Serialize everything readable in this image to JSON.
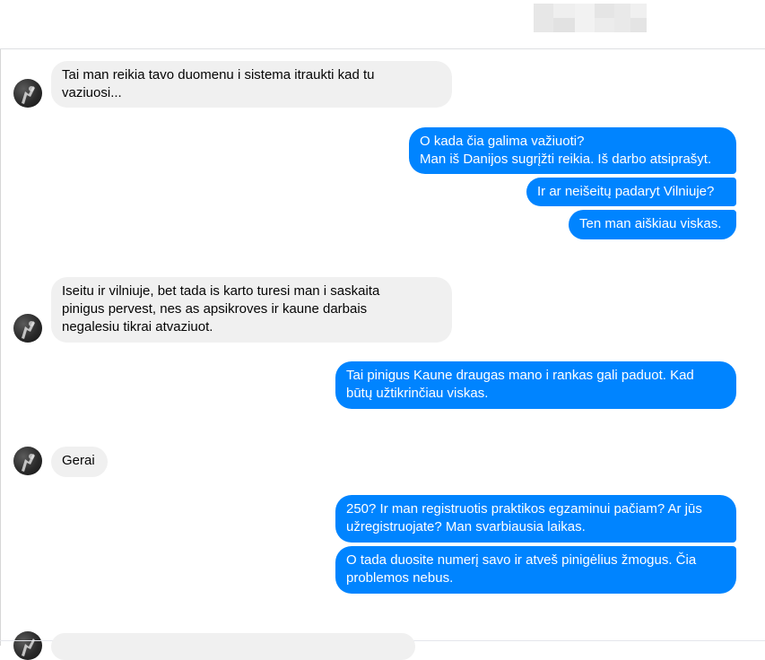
{
  "header": {
    "contact_name_blurred": true
  },
  "messages": [
    {
      "side": "in",
      "text": "Tai man reikia tavo duomenu i sistema itraukti kad tu\nvaziuosi..."
    },
    {
      "side": "out",
      "text": "O kada čia galima važiuoti?\nMan iš Danijos sugrįžti reikia. Iš darbo atsiprašyt."
    },
    {
      "side": "out",
      "text": "Ir ar neišeitų padaryt Vilniuje?"
    },
    {
      "side": "out",
      "text": "Ten man aiškiau viskas."
    },
    {
      "side": "in",
      "text": "Iseitu ir vilniuje, bet tada is karto turesi man i saskaita\npinigus pervest, nes as apsikroves ir kaune darbais\nnegalesiu tikrai atvaziuot."
    },
    {
      "side": "out",
      "text": "Tai pinigus Kaune draugas mano i rankas gali paduot. Kad\nbūtų užtikrinčiau viskas."
    },
    {
      "side": "in",
      "text": "Gerai"
    },
    {
      "side": "out",
      "text": "250? Ir man registruotis praktikos egzaminui pačiam? Ar jūs\nužregistruojate? Man svarbiausia laikas."
    },
    {
      "side": "out",
      "text": "O tada duosite numerį savo ir atveš pinigėlius žmogus. Čia\nproblemos nebus."
    }
  ],
  "colors": {
    "outgoing": "#0084ff",
    "incoming": "#f0f0f0"
  },
  "icons": {
    "avatar": "contact-avatar-photo"
  }
}
